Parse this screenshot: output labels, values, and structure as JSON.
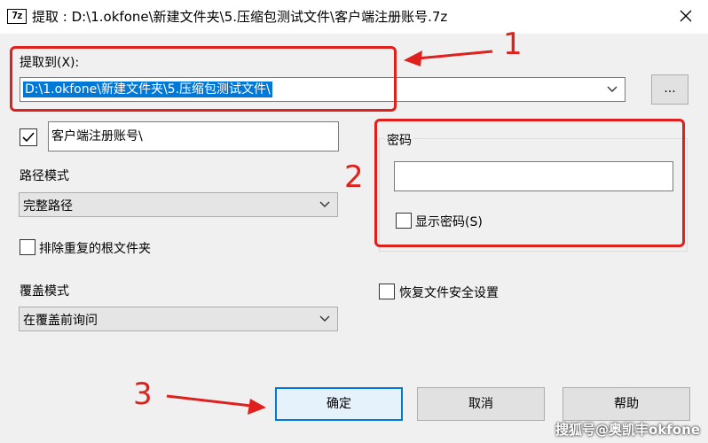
{
  "window": {
    "title": "提取 : D:\\1.okfone\\新建文件夹\\5.压缩包测试文件\\客户端注册账号.7z",
    "icon_text": "7z",
    "close_symbol": "×"
  },
  "extract_to": {
    "label": "提取到(X):",
    "value": "D:\\1.okfone\\新建文件夹\\5.压缩包测试文件\\",
    "browse_label": "..."
  },
  "subfolder": {
    "checked": true,
    "value": "客户端注册账号\\"
  },
  "path_mode": {
    "label": "路径模式",
    "selected": "完整路径"
  },
  "eliminate_duplicates": {
    "label": "排除重复的根文件夹",
    "checked": false
  },
  "overwrite_mode": {
    "label": "覆盖模式",
    "selected": "在覆盖前询问"
  },
  "password": {
    "group_label": "密码",
    "value": "",
    "show_label": "显示密码(S)",
    "show_checked": false
  },
  "restore_security": {
    "label": "恢复文件安全设置",
    "checked": false
  },
  "buttons": {
    "ok": "确定",
    "cancel": "取消",
    "help": "帮助"
  },
  "annotations": {
    "num1": "1",
    "num2": "2",
    "num3": "3",
    "color": "#e0201c"
  },
  "watermark": "搜狐号@奥凯丰okfone"
}
